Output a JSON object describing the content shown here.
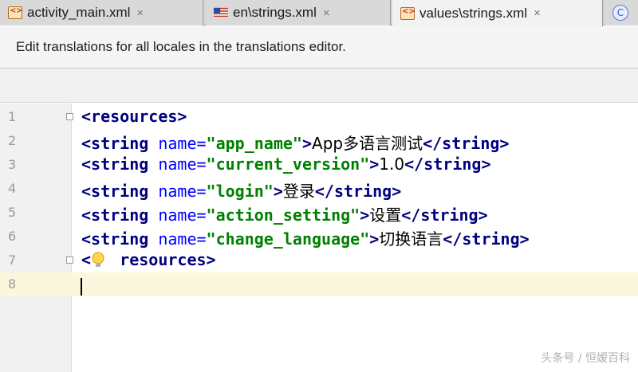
{
  "tabs": [
    {
      "label": "activity_main.xml",
      "icon": "xml-file-icon",
      "active": false
    },
    {
      "label": "en\\strings.xml",
      "icon": "us-flag-icon",
      "active": false
    },
    {
      "label": "values\\strings.xml",
      "icon": "xml-file-icon",
      "active": true
    },
    {
      "label": "C",
      "icon": "class-icon",
      "active": false
    }
  ],
  "close_glyph": "×",
  "notification": "Edit translations for all locales in the translations editor.",
  "editor": {
    "line_numbers": [
      "1",
      "2",
      "3",
      "4",
      "5",
      "6",
      "7",
      "8"
    ],
    "lines": [
      {
        "segments": [
          [
            "tag",
            "<resources>"
          ]
        ]
      },
      {
        "segments": [
          [
            "tag",
            "<string "
          ],
          [
            "attr",
            "name="
          ],
          [
            "val",
            "\"app_name\""
          ],
          [
            "tag",
            ">"
          ],
          [
            "txt",
            "App多语言测试"
          ],
          [
            "tag",
            "</string>"
          ]
        ]
      },
      {
        "segments": [
          [
            "tag",
            "<string "
          ],
          [
            "attr",
            "name="
          ],
          [
            "val",
            "\"current_version\""
          ],
          [
            "tag",
            ">"
          ],
          [
            "txt",
            "1.0"
          ],
          [
            "tag",
            "</string>"
          ]
        ]
      },
      {
        "segments": [
          [
            "tag",
            "<string "
          ],
          [
            "attr",
            "name="
          ],
          [
            "val",
            "\"login\""
          ],
          [
            "tag",
            ">"
          ],
          [
            "txt",
            "登录"
          ],
          [
            "tag",
            "</string>"
          ]
        ]
      },
      {
        "segments": [
          [
            "tag",
            "<string "
          ],
          [
            "attr",
            "name="
          ],
          [
            "val",
            "\"action_setting\""
          ],
          [
            "tag",
            ">"
          ],
          [
            "txt",
            "设置"
          ],
          [
            "tag",
            "</string>"
          ]
        ]
      },
      {
        "segments": [
          [
            "tag",
            "<string "
          ],
          [
            "attr",
            "name="
          ],
          [
            "val",
            "\"change_language\""
          ],
          [
            "tag",
            ">"
          ],
          [
            "txt",
            "切换语言"
          ],
          [
            "tag",
            "</string>"
          ]
        ]
      },
      {
        "segments": [
          [
            "tag",
            "<"
          ],
          [
            "tag",
            "   resources>"
          ]
        ]
      },
      {
        "segments": []
      }
    ],
    "current_line": 8
  },
  "watermark": "头条号 / 恒嫒百科",
  "colors": {
    "tag": "#000080",
    "attribute": "#0000ff",
    "value": "#008000",
    "current_line": "#fcf6dc"
  }
}
